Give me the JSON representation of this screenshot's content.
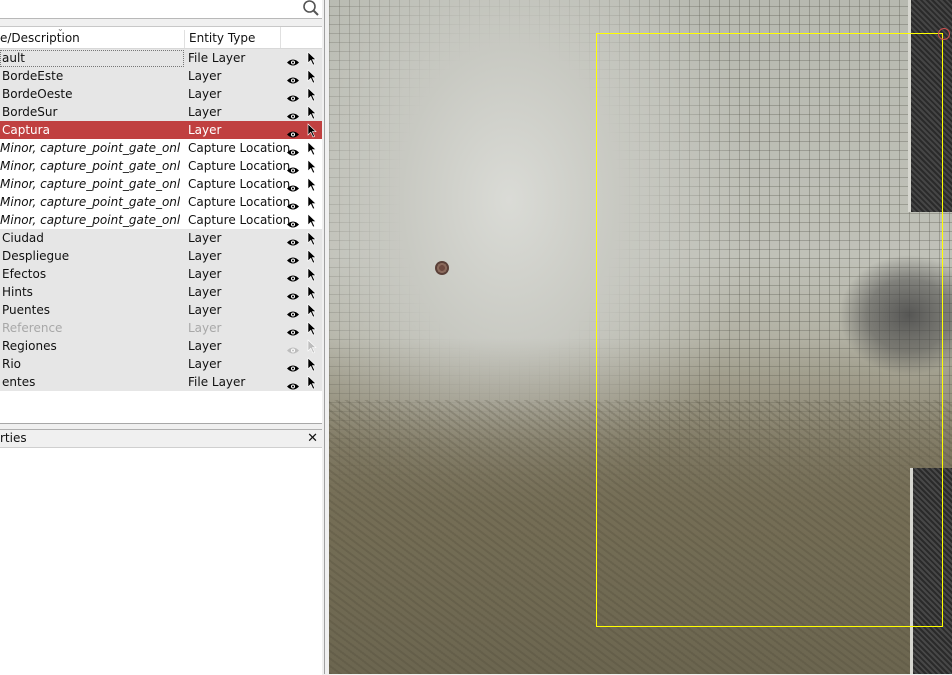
{
  "search": {
    "icon": "search-icon"
  },
  "table": {
    "columns": {
      "name": "e/Description",
      "type": "Entity Type"
    },
    "rows": [
      {
        "name": "ault",
        "type": "File Layer",
        "style": "layer",
        "eye_enabled": true,
        "cursor_enabled": true
      },
      {
        "name": "BordeEste",
        "type": "Layer",
        "style": "layer",
        "eye_enabled": true,
        "cursor_enabled": true
      },
      {
        "name": "BordeOeste",
        "type": "Layer",
        "style": "layer",
        "eye_enabled": true,
        "cursor_enabled": true
      },
      {
        "name": "BordeSur",
        "type": "Layer",
        "style": "layer",
        "eye_enabled": true,
        "cursor_enabled": true
      },
      {
        "name": "Captura",
        "type": "Layer",
        "style": "selected",
        "eye_enabled": true,
        "cursor_enabled": true
      },
      {
        "name": "Minor, capture_point_gate_only",
        "type": "Capture Location",
        "style": "loc",
        "eye_enabled": true,
        "cursor_enabled": true
      },
      {
        "name": "Minor, capture_point_gate_only",
        "type": "Capture Location",
        "style": "loc",
        "eye_enabled": true,
        "cursor_enabled": true
      },
      {
        "name": "Minor, capture_point_gate_only",
        "type": "Capture Location",
        "style": "loc",
        "eye_enabled": true,
        "cursor_enabled": true
      },
      {
        "name": "Minor, capture_point_gate_only",
        "type": "Capture Location",
        "style": "loc",
        "eye_enabled": true,
        "cursor_enabled": true
      },
      {
        "name": "Minor, capture_point_gate_only",
        "type": "Capture Location",
        "style": "loc",
        "eye_enabled": true,
        "cursor_enabled": true
      },
      {
        "name": "Ciudad",
        "type": "Layer",
        "style": "layer",
        "eye_enabled": true,
        "cursor_enabled": true
      },
      {
        "name": "Despliegue",
        "type": "Layer",
        "style": "layer",
        "eye_enabled": true,
        "cursor_enabled": true
      },
      {
        "name": "Efectos",
        "type": "Layer",
        "style": "layer",
        "eye_enabled": true,
        "cursor_enabled": true
      },
      {
        "name": "Hints",
        "type": "Layer",
        "style": "layer",
        "eye_enabled": true,
        "cursor_enabled": true
      },
      {
        "name": "Puentes",
        "type": "Layer",
        "style": "layer",
        "eye_enabled": true,
        "cursor_enabled": true
      },
      {
        "name": "Reference",
        "type": "Layer",
        "style": "dim",
        "eye_enabled": true,
        "cursor_enabled": true
      },
      {
        "name": "Regiones",
        "type": "Layer",
        "style": "layer",
        "eye_enabled": false,
        "cursor_enabled": false
      },
      {
        "name": "Rio",
        "type": "Layer",
        "style": "layer",
        "eye_enabled": true,
        "cursor_enabled": true
      },
      {
        "name": "entes",
        "type": "File Layer",
        "style": "layer",
        "eye_enabled": true,
        "cursor_enabled": true
      }
    ]
  },
  "properties": {
    "title": "rties",
    "close_label": "✕"
  },
  "colors": {
    "selected_row": "#c04040",
    "selection_rect": "#ffff00",
    "row_bg": "#e6e6e6"
  }
}
